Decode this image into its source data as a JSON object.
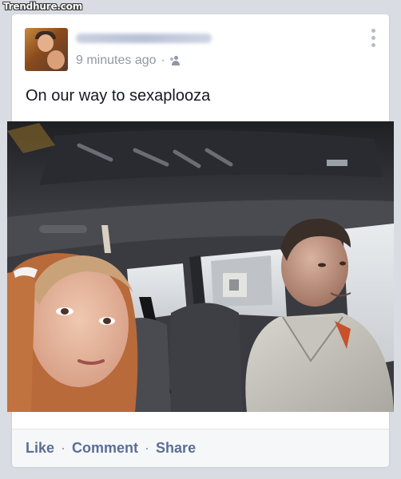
{
  "watermark": "Trendhure.com",
  "post": {
    "timestamp": "9 minutes ago",
    "separator": "·",
    "privacy_icon": "friends-icon",
    "more_icon": "more-vertical-icon",
    "text": "On our way to sexaplooza"
  },
  "actions": {
    "like": "Like",
    "comment": "Comment",
    "share": "Share",
    "separator": "·"
  },
  "colors": {
    "link": "#5a6e95",
    "meta": "#9197a3",
    "text": "#141823",
    "background": "#d9dce2"
  }
}
